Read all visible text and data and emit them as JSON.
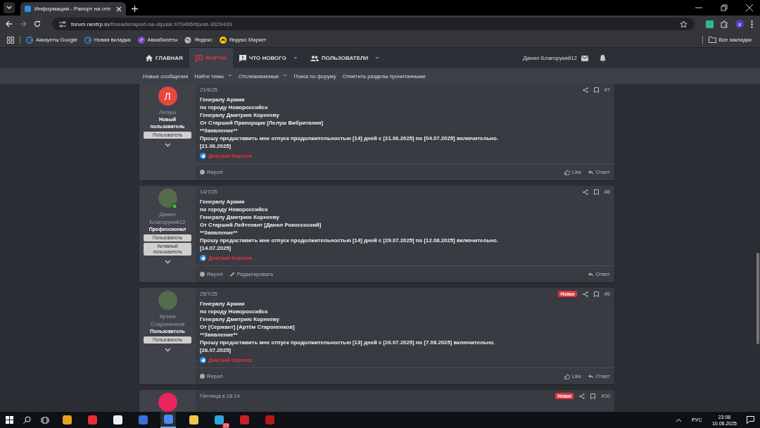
{
  "browser": {
    "tab_title": "Информация - Рапорт на отп",
    "url_host": "forum.nextrp.ru",
    "url_path": "/threads/raport-na-otpusk.970496/#post-3029439",
    "profile_initial": "a",
    "bookmarks": [
      {
        "kind": "google",
        "label": "Аккаунты Google"
      },
      {
        "kind": "google",
        "label": "Новая вкладка"
      },
      {
        "kind": "plane",
        "label": "Авиабилеты"
      },
      {
        "kind": "globe",
        "label": "Яндекс"
      },
      {
        "kind": "market",
        "label": "Яндекс Маркет"
      }
    ],
    "all_bookmarks": "Все закладки"
  },
  "nav": {
    "items": [
      {
        "kind": "home",
        "label": "ГЛАВНАЯ",
        "selected": false,
        "dropdown": false
      },
      {
        "kind": "forum",
        "label": "ФОРУМ",
        "selected": true,
        "dropdown": false
      },
      {
        "kind": "news",
        "label": "ЧТО НОВОГО",
        "selected": false,
        "dropdown": true
      },
      {
        "kind": "users",
        "label": "ПОЛЬЗОВАТЕЛИ",
        "selected": false,
        "dropdown": true
      }
    ],
    "user": "Данил Благорукий12"
  },
  "subnav": [
    {
      "label": "Новые сообщения",
      "dropdown": false
    },
    {
      "label": "Найти темы",
      "dropdown": true
    },
    {
      "label": "Отслеживаемые",
      "dropdown": true
    },
    {
      "label": "Поиск по форуму",
      "dropdown": false
    },
    {
      "label": "Отметить разделы прочитанными",
      "dropdown": false
    }
  ],
  "posts": [
    {
      "avatar": {
        "kind": "letter",
        "letter": "Л",
        "color": "#e8463c"
      },
      "online": false,
      "author": "Лелуш",
      "user_title": "Новый пользователь",
      "banners": [
        "Пользователь"
      ],
      "date": "21/6/25",
      "is_new": false,
      "number": "#7",
      "lines": [
        "Генералу Армии",
        "по городу Новороссийск",
        "Генералу Дмитрию Корнееву",
        "От Старший Прапорщик [Лелуш Вибритания]",
        "**Заявление**",
        "Прошу предоставить мне отпуск продолжительностью [14] дней с [21.06.2025] по [04.07.2025] включительно.",
        "[21.06.2025]"
      ],
      "reaction": "Дмитрий Корнеев.",
      "actions": [
        {
          "kind": "report",
          "label": "Report"
        },
        {
          "kind": "like",
          "label": "Like"
        },
        {
          "kind": "reply",
          "label": "Ответ"
        }
      ]
    },
    {
      "avatar": {
        "kind": "photo"
      },
      "online": true,
      "author": "Данил Благорукий12",
      "user_title": "Профессионал",
      "banners": [
        "Пользователь",
        "Активный пользователь"
      ],
      "date": "14/7/25",
      "is_new": false,
      "number": "#8",
      "lines": [
        "Генералу Армии",
        "по городу Новороссийск",
        "Генералу Дмитрию Корнееву",
        "От Старший Лейтенант [Данил Рокоссоский]",
        "**Заявление**",
        "Прошу предоставить мне отпуск продолжительностью [14] дней с [29.07.2025] по [12.08.2025] включительно.",
        "[14.07.2025]"
      ],
      "reaction": "Дмитрий Корнеев.",
      "actions": [
        {
          "kind": "report",
          "label": "Report"
        },
        {
          "kind": "edit",
          "label": "Редактировать"
        },
        {
          "kind": "reply",
          "label": "Ответ"
        }
      ]
    },
    {
      "avatar": {
        "kind": "photo"
      },
      "online": false,
      "author": "Артем Староненков",
      "user_title": "Пользователь",
      "banners": [
        "Пользователь"
      ],
      "date": "25/7/25",
      "is_new": true,
      "new_label": "Новое",
      "number": "#9",
      "lines": [
        "Генералу Армии",
        "по городу Новороссийск",
        "Генералу Дмитрию Корнееву",
        "От [Сержант] [Артём Староненков]",
        "**Заявление**",
        "Прошу предоставить мне отпуск продолжительностью [13] дней с [26.07.2025] по [7.08.2025] включительно.",
        "[26.07.2025]"
      ],
      "reaction": "Дмитрий Корнеев.",
      "actions": [
        {
          "kind": "report",
          "label": "Report"
        },
        {
          "kind": "like",
          "label": "Like"
        },
        {
          "kind": "reply",
          "label": "Ответ"
        }
      ]
    },
    {
      "avatar": {
        "kind": "letter",
        "color": "#e8245e"
      },
      "online": false,
      "date": "Пятница в 18:14",
      "is_new": true,
      "new_label": "Новое",
      "number": "#10"
    }
  ],
  "taskbar": {
    "apps": [
      {
        "kind": "media",
        "selected": false
      },
      {
        "kind": "yandex",
        "selected": false
      },
      {
        "kind": "ybrowser",
        "selected": false
      },
      {
        "kind": "notes",
        "selected": false
      },
      {
        "kind": "chrome",
        "selected": true
      },
      {
        "kind": "folder",
        "selected": false
      },
      {
        "kind": "telegram",
        "selected": false,
        "badge": "23"
      },
      {
        "kind": "redplay",
        "selected": false
      },
      {
        "kind": "redn",
        "selected": false
      }
    ],
    "language": "РУС",
    "time": "23:08",
    "date": "10.08.2025"
  }
}
